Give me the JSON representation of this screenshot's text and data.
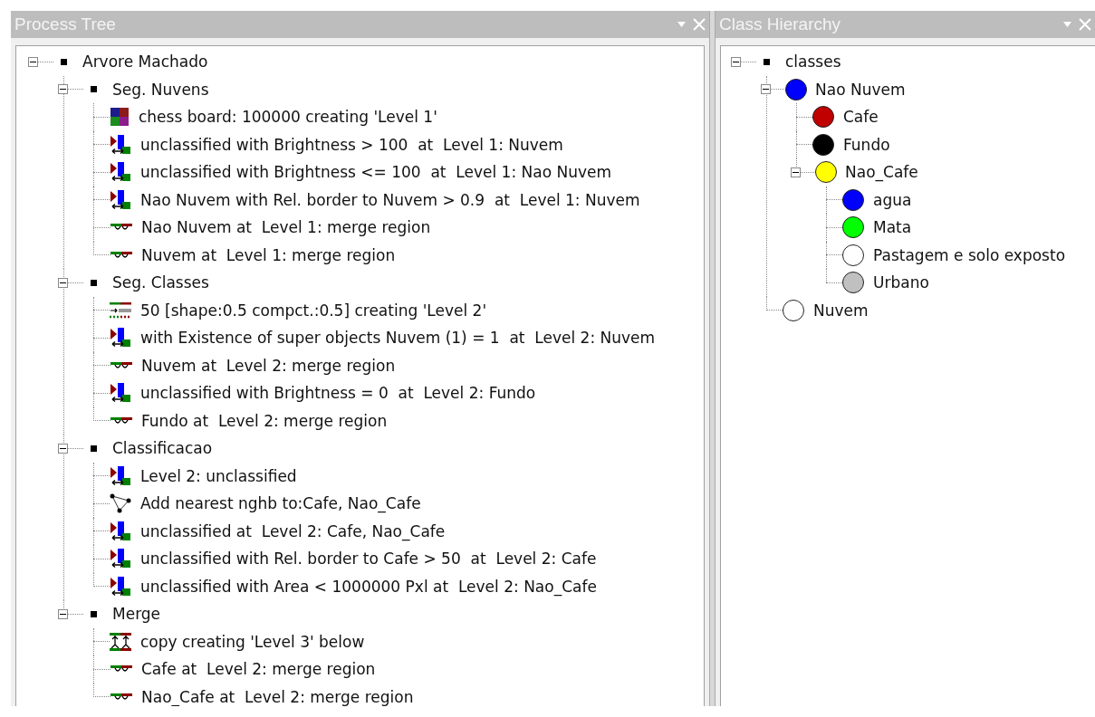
{
  "panels": [
    {
      "title": "Process Tree",
      "tree": [
        {
          "label": "Arvore Machado",
          "kind": "bullet",
          "expanded": true,
          "children": [
            {
              "label": "Seg. Nuvens",
              "kind": "bullet",
              "expanded": true,
              "children": [
                {
                  "label": "chess board: 100000 creating 'Level 1'",
                  "kind": "chessboard"
                },
                {
                  "label": "unclassified with Brightness > 100  at  Level 1: Nuvem",
                  "kind": "classify"
                },
                {
                  "label": "unclassified with Brightness <= 100  at  Level 1: Nao Nuvem",
                  "kind": "classify"
                },
                {
                  "label": "Nao Nuvem with Rel. border to Nuvem > 0.9  at  Level 1: Nuvem",
                  "kind": "classify"
                },
                {
                  "label": "Nao Nuvem at  Level 1: merge region",
                  "kind": "merge"
                },
                {
                  "label": "Nuvem at  Level 1: merge region",
                  "kind": "merge"
                }
              ]
            },
            {
              "label": "Seg. Classes",
              "kind": "bullet",
              "expanded": true,
              "children": [
                {
                  "label": "50 [shape:0.5 compct.:0.5] creating 'Level 2'",
                  "kind": "segmentation"
                },
                {
                  "label": "with Existence of super objects Nuvem (1) = 1  at  Level 2: Nuvem",
                  "kind": "classify"
                },
                {
                  "label": "Nuvem at  Level 2: merge region",
                  "kind": "merge"
                },
                {
                  "label": "unclassified with Brightness = 0  at  Level 2: Fundo",
                  "kind": "classify"
                },
                {
                  "label": "Fundo at  Level 2: merge region",
                  "kind": "merge"
                }
              ]
            },
            {
              "label": "Classificacao",
              "kind": "bullet",
              "expanded": true,
              "children": [
                {
                  "label": "Level 2: unclassified",
                  "kind": "classify"
                },
                {
                  "label": "Add nearest nghb to:Cafe, Nao_Cafe",
                  "kind": "nearest"
                },
                {
                  "label": "unclassified at  Level 2: Cafe, Nao_Cafe",
                  "kind": "classify"
                },
                {
                  "label": "unclassified with Rel. border to Cafe > 50  at  Level 2: Cafe",
                  "kind": "classify"
                },
                {
                  "label": "unclassified with Area < 1000000 Pxl at  Level 2: Nao_Cafe",
                  "kind": "classify"
                }
              ]
            },
            {
              "label": "Merge",
              "kind": "bullet",
              "expanded": true,
              "children": [
                {
                  "label": "copy creating 'Level 3' below",
                  "kind": "copy"
                },
                {
                  "label": "Cafe at  Level 2: merge region",
                  "kind": "merge"
                },
                {
                  "label": "Nao_Cafe at  Level 2: merge region",
                  "kind": "merge"
                }
              ]
            }
          ]
        }
      ]
    },
    {
      "title": "Class Hierarchy",
      "tree": [
        {
          "label": "classes",
          "kind": "bullet",
          "expanded": true,
          "children": [
            {
              "label": "Nao Nuvem",
              "kind": "class",
              "color": "#0000ff",
              "expanded": true,
              "children": [
                {
                  "label": "Cafe",
                  "kind": "class",
                  "color": "#c00000"
                },
                {
                  "label": "Fundo",
                  "kind": "class",
                  "color": "#000000"
                },
                {
                  "label": "Nao_Cafe",
                  "kind": "class",
                  "color": "#ffff00",
                  "expanded": true,
                  "children": [
                    {
                      "label": "agua",
                      "kind": "class",
                      "color": "#0000ff"
                    },
                    {
                      "label": "Mata",
                      "kind": "class",
                      "color": "#00ff00"
                    },
                    {
                      "label": "Pastagem e solo exposto",
                      "kind": "class",
                      "color": "#ffffff"
                    },
                    {
                      "label": "Urbano",
                      "kind": "class",
                      "color": "#c0c0c0"
                    }
                  ]
                }
              ]
            },
            {
              "label": "Nuvem",
              "kind": "class",
              "color": "#ffffff"
            }
          ]
        }
      ]
    }
  ]
}
